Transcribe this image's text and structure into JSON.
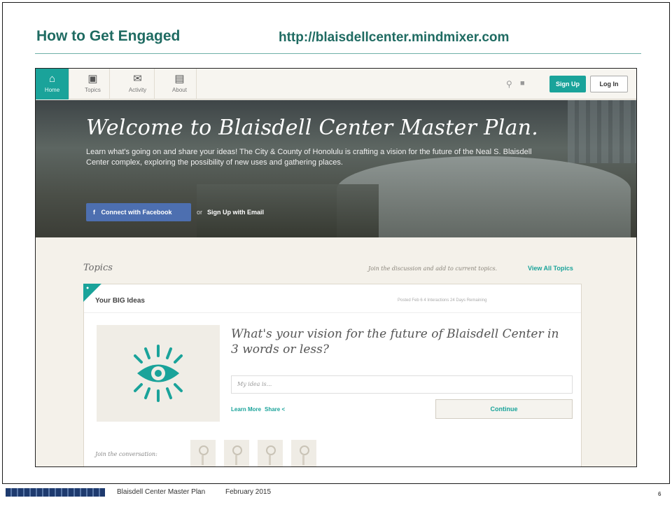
{
  "slide": {
    "title": "How to Get Engaged",
    "url": "http://blaisdellcenter.mindmixer.com",
    "footer_text": "Blaisdell Center Master Plan",
    "footer_date": "February 2015",
    "page_number": "6"
  },
  "nav": {
    "items": [
      {
        "label": "Home",
        "icon": "home-icon"
      },
      {
        "label": "Topics",
        "icon": "topics-icon"
      },
      {
        "label": "Activity",
        "icon": "activity-icon"
      },
      {
        "label": "About",
        "icon": "about-icon"
      }
    ],
    "signup_label": "Sign Up",
    "login_label": "Log In"
  },
  "hero": {
    "title": "Welcome to Blaisdell Center Master Plan.",
    "description": "Learn what's going on and share your ideas! The City & County of Honolulu is crafting a vision for the future of the Neal S. Blaisdell Center complex, exploring the possibility of new uses and gathering places.",
    "facebook_label": "Connect with Facebook",
    "or_label": "or",
    "email_signup_label": "Sign Up with Email"
  },
  "topics": {
    "heading": "Topics",
    "join_text": "Join the discussion and add to current topics.",
    "view_all_label": "View All Topics"
  },
  "card": {
    "title": "Your BIG Ideas",
    "meta": "Posted Feb 6   4 Interactions   24 Days Remaining",
    "question": "What's your vision for the future of Blaisdell Center in 3 words or less?",
    "input_placeholder": "My idea is...",
    "learn_more_label": "Learn More",
    "share_label": "Share",
    "continue_label": "Continue",
    "join_conversation": "Join the conversation:"
  },
  "colors": {
    "brand_teal": "#1aa39a",
    "title_green": "#1f6b62",
    "facebook_blue": "#4d6fb0"
  }
}
